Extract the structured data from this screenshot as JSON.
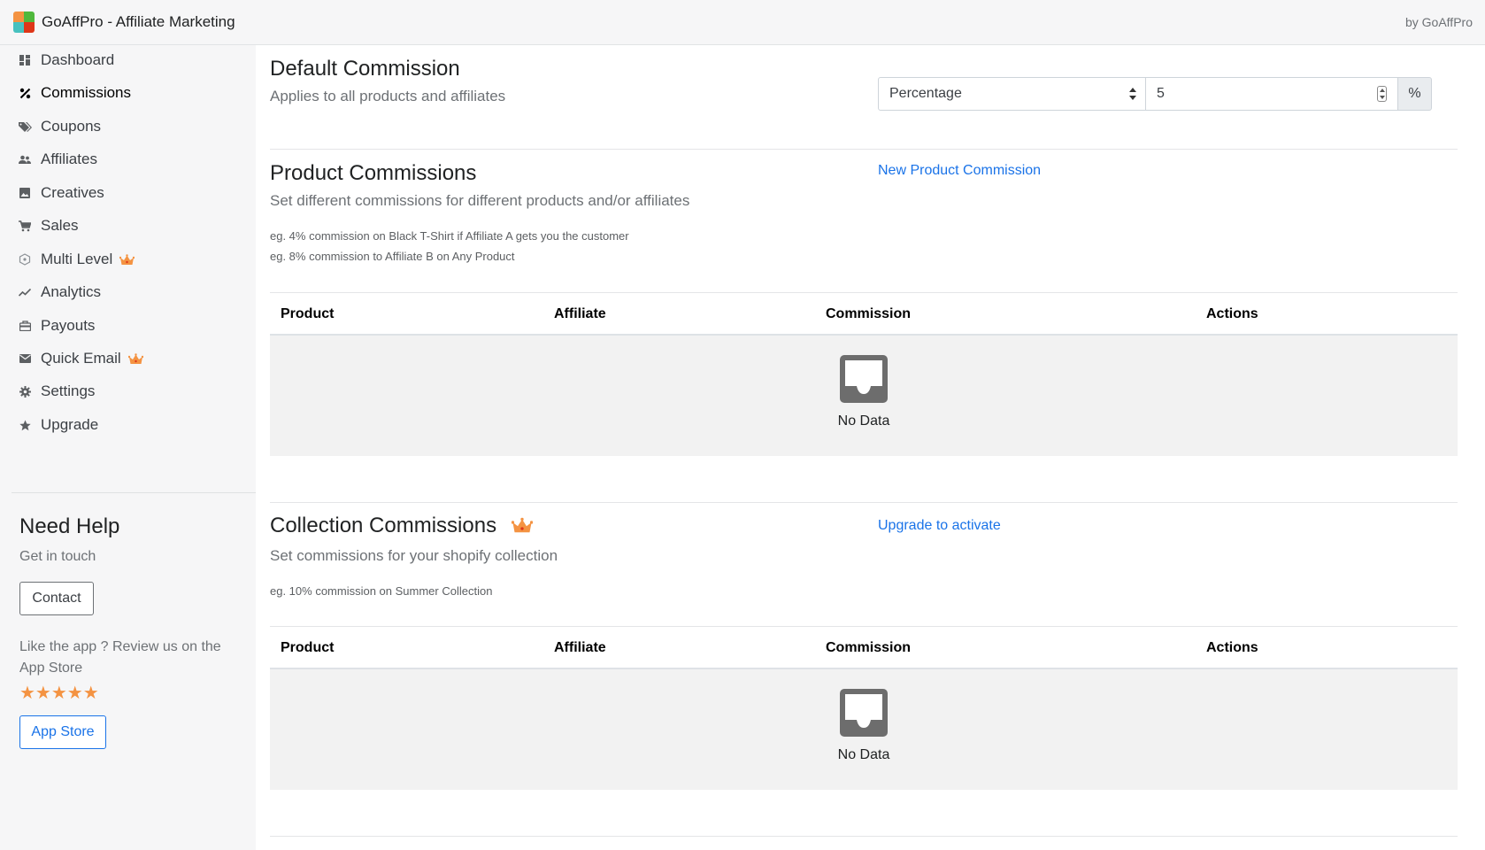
{
  "header": {
    "app_title": "GoAffPro - Affiliate Marketing",
    "by_label": "by GoAffPro"
  },
  "sidebar": {
    "items": [
      {
        "label": "Dashboard",
        "icon": "dashboard-icon"
      },
      {
        "label": "Commissions",
        "icon": "percent-icon",
        "active": true
      },
      {
        "label": "Coupons",
        "icon": "tags-icon"
      },
      {
        "label": "Affiliates",
        "icon": "users-icon"
      },
      {
        "label": "Creatives",
        "icon": "image-icon"
      },
      {
        "label": "Sales",
        "icon": "cart-icon"
      },
      {
        "label": "Multi Level",
        "icon": "network-icon",
        "premium": true
      },
      {
        "label": "Analytics",
        "icon": "trend-icon"
      },
      {
        "label": "Payouts",
        "icon": "payouts-icon"
      },
      {
        "label": "Quick Email",
        "icon": "mail-icon",
        "premium": true
      },
      {
        "label": "Settings",
        "icon": "gear-icon"
      },
      {
        "label": "Upgrade",
        "icon": "star-icon"
      }
    ],
    "help_title": "Need Help",
    "help_sub": "Get in touch",
    "contact_label": "Contact",
    "review_text": "Like the app ? Review us on the App Store",
    "stars": "★★★★★",
    "appstore_label": "App Store"
  },
  "default_commission": {
    "title": "Default Commission",
    "description": "Applies to all products and affiliates",
    "type_value": "Percentage",
    "amount_value": "5",
    "unit": "%"
  },
  "product_commissions": {
    "title": "Product Commissions",
    "description": "Set different commissions for different products and/or affiliates",
    "example_1": "eg. 4% commission on Black T-Shirt if Affiliate A gets you the customer",
    "example_2": "eg. 8% commission to Affiliate B on Any Product",
    "action_link": "New Product Commission",
    "columns": [
      "Product",
      "Affiliate",
      "Commission",
      "Actions"
    ],
    "empty_text": "No Data"
  },
  "collection_commissions": {
    "title": "Collection Commissions",
    "description": "Set commissions for your shopify collection",
    "example_1": "eg. 10% commission on Summer Collection",
    "action_link": "Upgrade to activate",
    "columns": [
      "Product",
      "Affiliate",
      "Commission",
      "Actions"
    ],
    "empty_text": "No Data"
  },
  "colors": {
    "accent": "#1a73e8",
    "crown": "#f49342",
    "sidebar_bg": "#f6f6f7",
    "empty_bg": "#f2f2f2"
  }
}
